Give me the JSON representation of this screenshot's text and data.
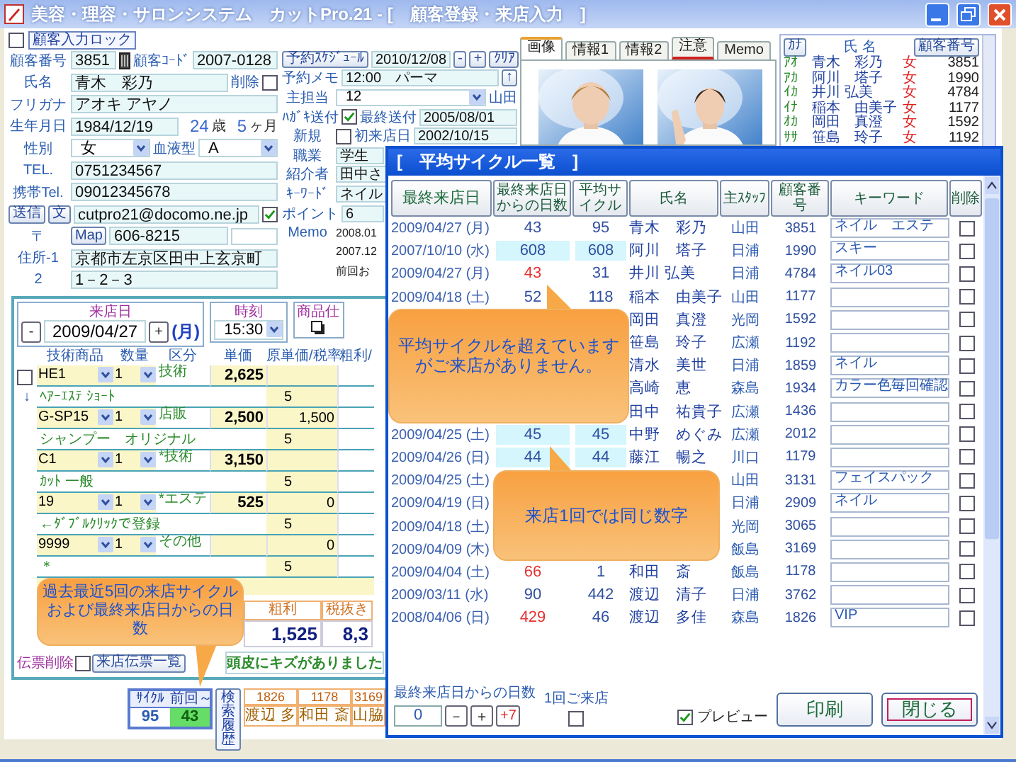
{
  "window": {
    "title": "美容・理容・サロンシステム　カットPro.21 - [　顧客登録・来店入力　]"
  },
  "lock": {
    "label": "顧客入力ロック",
    "checked": false
  },
  "left_rows": [
    {
      "items": [
        {
          "kind": "label",
          "text": "顧客番号"
        },
        {
          "kind": "field",
          "text": "3851"
        },
        {
          "kind": "icon"
        },
        {
          "kind": "label",
          "text": "顧客ｺｰﾄﾞ"
        },
        {
          "kind": "field",
          "text": "2007-0128"
        }
      ]
    },
    {
      "items": [
        {
          "kind": "label",
          "text": "氏名"
        },
        {
          "kind": "field",
          "text": "青木　彩乃"
        },
        {
          "kind": "label",
          "text": "削除"
        },
        {
          "kind": "check",
          "checked": false
        }
      ]
    },
    {
      "items": [
        {
          "kind": "label",
          "text": "フリガナ"
        },
        {
          "kind": "field",
          "text": "アオキ アヤノ"
        }
      ]
    },
    {
      "items": [
        {
          "kind": "label",
          "text": "生年月日"
        },
        {
          "kind": "field",
          "text": "1984/12/19"
        },
        {
          "kind": "number",
          "text": "24"
        },
        {
          "kind": "unit",
          "text": "歳"
        },
        {
          "kind": "number",
          "text": "5"
        },
        {
          "kind": "unit",
          "text": "ヶ月"
        }
      ]
    },
    {
      "items": [
        {
          "kind": "label",
          "text": "性別"
        },
        {
          "kind": "select",
          "text": "女"
        },
        {
          "kind": "label",
          "text": "血液型"
        },
        {
          "kind": "select",
          "text": "A"
        }
      ]
    },
    {
      "items": [
        {
          "kind": "label",
          "text": "TEL."
        },
        {
          "kind": "field",
          "text": "0751234567"
        }
      ]
    },
    {
      "items": [
        {
          "kind": "label",
          "text": "携帯Tel."
        },
        {
          "kind": "field",
          "text": "09012345678"
        }
      ]
    },
    {
      "items": [
        {
          "kind": "button",
          "text": "送信"
        },
        {
          "kind": "button",
          "text": "文"
        },
        {
          "kind": "field",
          "text": "cutpro21@docomo.ne.jp"
        },
        {
          "kind": "check",
          "checked": true
        }
      ]
    },
    {
      "items": [
        {
          "kind": "label",
          "text": "〒"
        },
        {
          "kind": "button",
          "text": "Map"
        },
        {
          "kind": "field",
          "text": "606-8215"
        },
        {
          "kind": "empty-field"
        }
      ]
    },
    {
      "items": [
        {
          "kind": "label",
          "text": "住所-1"
        },
        {
          "kind": "field",
          "text": "京都市左京区田中上玄京町"
        }
      ]
    },
    {
      "items": [
        {
          "kind": "label",
          "text": "2"
        },
        {
          "kind": "field",
          "text": "1－2－3"
        }
      ]
    }
  ],
  "right_rows": [
    {
      "items": [
        {
          "kind": "button",
          "text": "予約ｽｹｼﾞｭｰﾙ"
        },
        {
          "kind": "field",
          "text": "2010/12/08"
        },
        {
          "kind": "button",
          "text": "-"
        },
        {
          "kind": "button",
          "text": "+"
        },
        {
          "kind": "button",
          "text": "ｸﾘｱ"
        }
      ]
    },
    {
      "items": [
        {
          "kind": "label",
          "text": "予約メモ"
        },
        {
          "kind": "field",
          "text": "12:00　パーマ"
        },
        {
          "kind": "button",
          "text": "↑"
        }
      ]
    },
    {
      "items": [
        {
          "kind": "label",
          "text": "主担当"
        },
        {
          "kind": "select",
          "text": "12"
        },
        {
          "kind": "text",
          "text": "山田"
        }
      ]
    },
    {
      "items": [
        {
          "kind": "label",
          "text": "ﾊｶﾞｷ送付"
        },
        {
          "kind": "check",
          "checked": true
        },
        {
          "kind": "text",
          "text": "最終送付"
        },
        {
          "kind": "field",
          "text": "2005/08/01"
        }
      ]
    },
    {
      "items": [
        {
          "kind": "label",
          "text": "新規"
        },
        {
          "kind": "check",
          "checked": false
        },
        {
          "kind": "text",
          "text": "初来店日"
        },
        {
          "kind": "field",
          "text": "2002/10/15"
        }
      ]
    },
    {
      "items": [
        {
          "kind": "label",
          "text": "職業"
        },
        {
          "kind": "field",
          "text": "学生"
        }
      ]
    },
    {
      "items": [
        {
          "kind": "label",
          "text": "紹介者"
        },
        {
          "kind": "field",
          "text": "田中さ"
        }
      ]
    },
    {
      "items": [
        {
          "kind": "label",
          "text": "ｷｰﾜｰﾄﾞ"
        },
        {
          "kind": "field",
          "text": "ネイル"
        }
      ]
    },
    {
      "items": [
        {
          "kind": "label",
          "text": "ポイント"
        },
        {
          "kind": "field",
          "text": "6"
        }
      ]
    },
    {
      "items": [
        {
          "kind": "label",
          "text": "Memo"
        },
        {
          "kind": "memo",
          "text": "2008.01"
        }
      ]
    },
    {
      "items": [
        {
          "kind": "memo",
          "text": "2007.12"
        }
      ]
    },
    {
      "items": [
        {
          "kind": "memo",
          "text": "前回お"
        }
      ]
    }
  ],
  "photo_panel": {
    "tabs": [
      {
        "label": "画像",
        "selected": true,
        "flagged": false
      },
      {
        "label": "情報1",
        "selected": false,
        "flagged": false
      },
      {
        "label": "情報2",
        "selected": false,
        "flagged": false
      },
      {
        "label": "注意",
        "selected": false,
        "flagged": true
      },
      {
        "label": "Memo",
        "selected": false,
        "flagged": false
      }
    ]
  },
  "kana_list": {
    "kana_button": "ｶﾅ",
    "name_header": "氏 名",
    "number_button": "顧客番号",
    "rows": [
      {
        "kana": "ｱｵ",
        "name": "青木　彩乃",
        "sex": "女",
        "number": "3851"
      },
      {
        "kana": "ｱｶ",
        "name": "阿川　塔子",
        "sex": "女",
        "number": "1990"
      },
      {
        "kana": "ｲｶ",
        "name": "井川 弘美",
        "sex": "女",
        "number": "4784"
      },
      {
        "kana": "ｲﾅ",
        "name": "稲本　由美子",
        "sex": "女",
        "number": "1177"
      },
      {
        "kana": "ｵｶ",
        "name": "岡田　真澄",
        "sex": "女",
        "number": "1592"
      },
      {
        "kana": "ｻｻ",
        "name": "笹島　玲子",
        "sex": "女",
        "number": "1192"
      }
    ]
  },
  "visit": {
    "date_label": "来店日",
    "date_buttons": [
      "-",
      "+"
    ],
    "date": "2009/04/27",
    "weekday": "(月)",
    "time_label": "時刻",
    "time": "15:30",
    "product_label": "商品仕",
    "columns": [
      "技術商品",
      "数量",
      "区分",
      "単価",
      "原単価/税率",
      "粗利/"
    ],
    "select_all": {
      "checked": false
    },
    "arrow": "↓",
    "items": [
      {
        "code": "HE1",
        "qty": "1",
        "category": "技術",
        "price": "2,625",
        "name": "ﾍｱｰｴｽﾃ ｼｮｰﾄ",
        "tax": "5"
      },
      {
        "code": "G-SP15",
        "qty": "1",
        "category": "店販",
        "price": "2,500",
        "cost": "1,500",
        "name": "シャンプー　オリジナル",
        "tax": "5"
      },
      {
        "code": "C1",
        "qty": "1",
        "category": "*技術",
        "price": "3,150",
        "name": "ｶｯﾄ 一般",
        "tax": "5"
      },
      {
        "code": "19",
        "qty": "1",
        "category": "*エステ",
        "price": "525",
        "cost": "0",
        "name": "←ﾀﾞﾌﾞﾙｸﾘｯｸで登録",
        "tax": "5"
      },
      {
        "code": "9999",
        "qty": "1",
        "category": "その他",
        "cost": "0",
        "name": "＊",
        "tax": "5"
      }
    ],
    "totals": [
      {
        "label": "粗利",
        "value": "1,525"
      },
      {
        "label": "税抜き",
        "value": "8,3"
      }
    ],
    "delete_label": "伝票削除",
    "delete_checked": false,
    "list_button": "来店伝票一覧",
    "memo": "頭皮にキズがありました"
  },
  "cycle": {
    "cycle_label": "ｻｲｸﾙ",
    "since_label": "前回～",
    "cycle": "95",
    "since": "43",
    "search_button": "検索履歴",
    "recent": [
      {
        "number": "1826",
        "name": "渡辺 多"
      },
      {
        "number": "1178",
        "name": "和田 斎"
      },
      {
        "number": "3169",
        "name": "山脇"
      }
    ]
  },
  "dialog": {
    "title": "[　平均サイクル一覧　]",
    "columns": [
      "最終来店日",
      "最終来店日からの日数",
      "平均サイクル",
      "氏名",
      "主ｽﾀｯﾌ",
      "顧客番号",
      "キーワード",
      "削除"
    ],
    "rows": [
      {
        "date": "2009/04/27 (月)",
        "days": "43",
        "cycle": "95",
        "name": "青木　彩乃",
        "staff": "山田",
        "number": "3851",
        "keyword": "ネイル　エステ",
        "highlight": false,
        "over": false,
        "delete": false
      },
      {
        "date": "2007/10/10 (水)",
        "days": "608",
        "cycle": "608",
        "name": "阿川　塔子",
        "staff": "日浦",
        "number": "1990",
        "keyword": "スキー",
        "highlight": true,
        "over": false,
        "delete": false
      },
      {
        "date": "2009/04/27 (月)",
        "days": "43",
        "cycle": "31",
        "name": "井川 弘美",
        "staff": "日浦",
        "number": "4784",
        "keyword": "ネイル03",
        "highlight": false,
        "over": true,
        "delete": false
      },
      {
        "date": "2009/04/18 (土)",
        "days": "52",
        "cycle": "118",
        "name": "稲本　由美子",
        "staff": "山田",
        "number": "1177",
        "highlight": false,
        "over": false,
        "delete": false
      },
      {
        "name": "岡田　真澄",
        "staff": "光岡",
        "number": "1592",
        "delete": false
      },
      {
        "name": "笹島　玲子",
        "staff": "広瀬",
        "number": "1192",
        "delete": false
      },
      {
        "name": "清水　美世",
        "staff": "日浦",
        "number": "1859",
        "keyword": "ネイル",
        "delete": false
      },
      {
        "name": "高崎　恵",
        "staff": "森島",
        "number": "1934",
        "keyword": "カラー色毎回確認",
        "delete": false
      },
      {
        "name": "田中　祐貴子",
        "staff": "広瀬",
        "number": "1436",
        "delete": false
      },
      {
        "date": "2009/04/25 (土)",
        "days": "45",
        "cycle": "45",
        "name": "中野　めぐみ",
        "staff": "広瀬",
        "number": "2012",
        "highlight": true,
        "over": false,
        "delete": false
      },
      {
        "date": "2009/04/26 (日)",
        "days": "44",
        "cycle": "44",
        "name": "藤江　暢之",
        "staff": "川口",
        "number": "1179",
        "highlight": true,
        "over": false,
        "delete": false
      },
      {
        "date": "2009/04/25 (土)",
        "staff": "山田",
        "number": "3131",
        "keyword": "フェイスパック",
        "delete": false
      },
      {
        "date": "2009/04/19 (日)",
        "staff": "日浦",
        "number": "2909",
        "keyword": "ネイル",
        "delete": false
      },
      {
        "date": "2009/04/18 (土)",
        "staff": "光岡",
        "number": "3065",
        "delete": false
      },
      {
        "date": "2009/04/09 (木)",
        "staff": "飯島",
        "number": "3169",
        "delete": false
      },
      {
        "date": "2009/04/04 (土)",
        "days": "66",
        "cycle": "1",
        "name": "和田　斎",
        "staff": "飯島",
        "number": "1178",
        "highlight": false,
        "over": true,
        "delete": false
      },
      {
        "date": "2009/03/11 (水)",
        "days": "90",
        "cycle": "442",
        "name": "渡辺　清子",
        "staff": "日浦",
        "number": "3762",
        "highlight": false,
        "over": false,
        "delete": false
      },
      {
        "date": "2008/04/06 (日)",
        "days": "429",
        "cycle": "46",
        "name": "渡辺　多佳",
        "staff": "森島",
        "number": "1826",
        "keyword": "VIP",
        "highlight": false,
        "over": true,
        "delete": false
      }
    ],
    "days_label": "最終来店日からの日数",
    "days_value": "0",
    "steps": [
      {
        "text": "－",
        "kind": "plain"
      },
      {
        "text": "＋",
        "kind": "plain"
      },
      {
        "text": "+7",
        "kind": "accent"
      }
    ],
    "once_label": "1回ご来店",
    "once_checked": false,
    "preview": {
      "label": "プレビュー",
      "checked": true
    },
    "print_button": "印刷",
    "close_button": "閉じる"
  },
  "callouts": [
    {
      "text": "平均サイクルを超えていますがご来店がありません。"
    },
    {
      "text": "来店1回では同じ数字"
    },
    {
      "text": "過去最近5回の来店サイクルおよび最終来店日からの日数"
    }
  ]
}
